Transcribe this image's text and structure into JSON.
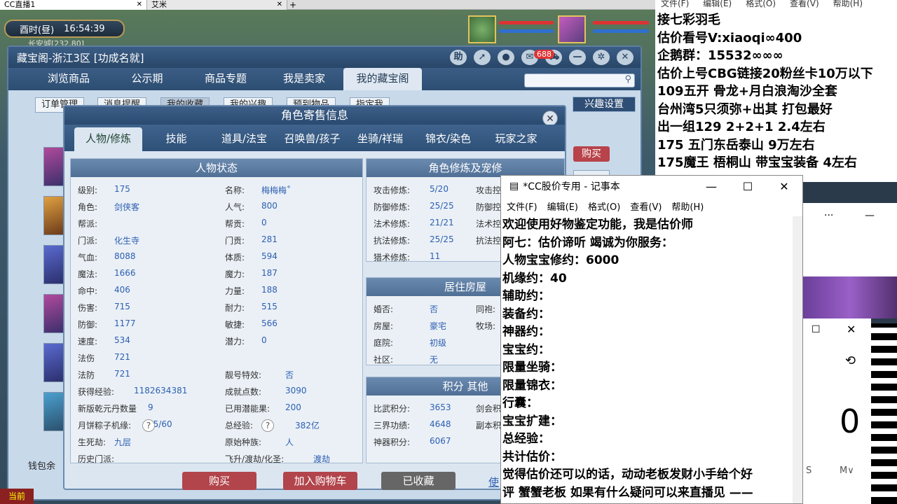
{
  "browser": {
    "tabs": [
      {
        "label": "CC直播1",
        "active": true
      },
      {
        "label": "艾米",
        "active": false
      }
    ]
  },
  "game": {
    "clock": {
      "period": "酉时(昼)",
      "time": "16:54:39"
    },
    "location": "长安城[232,80]",
    "window_title": "藏宝阁-浙江3区 [功成名就]",
    "help_label": "助",
    "cart_badge": "688",
    "nav_tabs": [
      "浏览商品",
      "公示期",
      "商品专题",
      "我是卖家",
      "我的藏宝阁"
    ],
    "sub_tabs": [
      "订单管理",
      "消息提醒",
      "我的收藏",
      "我的兴趣",
      "预到物品",
      "指定我"
    ],
    "interest_setting": "兴趣设置",
    "buy_side": "购买",
    "wallet": "钱包余"
  },
  "dialog": {
    "title": "角色寄售信息",
    "tabs": [
      "人物/修炼",
      "技能",
      "道具/法宝",
      "召唤兽/孩子",
      "坐骑/祥瑞",
      "锦衣/染色",
      "玩家之家"
    ],
    "status_title": "人物状态",
    "col1": [
      {
        "label": "级别:",
        "value": "175"
      },
      {
        "label": "角色:",
        "value": "剑侠客"
      },
      {
        "label": "帮派:",
        "value": ""
      },
      {
        "label": "门派:",
        "value": "化生寺"
      },
      {
        "label": "气血:",
        "value": "8088"
      },
      {
        "label": "魔法:",
        "value": "1666"
      },
      {
        "label": "命中:",
        "value": "406"
      },
      {
        "label": "伤害:",
        "value": "715"
      },
      {
        "label": "防御:",
        "value": "1177"
      },
      {
        "label": "速度:",
        "value": "534"
      },
      {
        "label": "法伤",
        "value": "721"
      },
      {
        "label": "法防",
        "value": "721"
      },
      {
        "label": "获得经验:",
        "value": "1182634381"
      },
      {
        "label": "新版乾元丹数量",
        "value": "9"
      },
      {
        "label": "月饼粽子机缘:",
        "value": "35/60"
      },
      {
        "label": "生死劫:",
        "value": "九层"
      },
      {
        "label": "历史门派:",
        "value": ""
      }
    ],
    "col2": [
      {
        "label": "名称:",
        "value": "梅梅梅˚"
      },
      {
        "label": "人气:",
        "value": "800"
      },
      {
        "label": "帮贡:",
        "value": "0"
      },
      {
        "label": "门贡:",
        "value": "281"
      },
      {
        "label": "体质:",
        "value": "594"
      },
      {
        "label": "魔力:",
        "value": "187"
      },
      {
        "label": "力量:",
        "value": "188"
      },
      {
        "label": "耐力:",
        "value": "515"
      },
      {
        "label": "敏捷:",
        "value": "566"
      },
      {
        "label": "潜力:",
        "value": "0"
      },
      {
        "label": "靓号特效:",
        "value": "否"
      },
      {
        "label": "成就点数:",
        "value": "3090"
      },
      {
        "label": "已用潜能果:",
        "value": "200"
      },
      {
        "label": "总经验:",
        "value": "382亿"
      },
      {
        "label": "原始种族:",
        "value": "人"
      },
      {
        "label": "飞升/渡劫/化圣:",
        "value": "渡劫"
      }
    ],
    "cultivation_title": "角色修炼及宠修",
    "cultivation": [
      {
        "label": "攻击修炼:",
        "value": "5/20",
        "side": "攻击控"
      },
      {
        "label": "防御修炼:",
        "value": "25/25",
        "side": "防御控"
      },
      {
        "label": "法术修炼:",
        "value": "21/21",
        "side": "法术控"
      },
      {
        "label": "抗法修炼:",
        "value": "25/25",
        "side": "抗法控"
      },
      {
        "label": "猎术修炼:",
        "value": "11",
        "side": ""
      }
    ],
    "house_title": "居住房屋",
    "house": [
      {
        "label": "婚否:",
        "value": "否",
        "side": "同袍:"
      },
      {
        "label": "房屋:",
        "value": "豪宅",
        "side": "牧场:"
      },
      {
        "label": "庭院:",
        "value": "初级",
        "side": ""
      },
      {
        "label": "社区:",
        "value": "无",
        "side": ""
      }
    ],
    "score_title": "积分 其他",
    "score": [
      {
        "label": "比武积分:",
        "value": "3653",
        "side": "剑会积"
      },
      {
        "label": "三界功绩:",
        "value": "4648",
        "side": "副本积"
      },
      {
        "label": "神器积分:",
        "value": "6067",
        "side": ""
      }
    ],
    "buttons": {
      "buy": "购买",
      "add_cart": "加入购物车",
      "collected": "已收藏",
      "link": "使"
    }
  },
  "overlay_text": {
    "menu": [
      "文件(F)",
      "编辑(E)",
      "格式(O)",
      "查看(V)",
      "帮助(H)"
    ],
    "lines": [
      "  接七彩羽毛",
      "估价看号V:xiaoqi∞400",
      "企鹅群：15532∞∞∞",
      "估价上号CBG链接20粉丝卡10万以下",
      "109五开 骨龙+月白浪淘沙全套",
      "台州湾5只须弥+出其 打包最好",
      "出一组129 2+2+1    2.4左右",
      "175 五门东岳泰山  9万左右",
      "175魔王 梧桐山  带宝宝装备 4左右"
    ]
  },
  "notepad": {
    "title": "*CC股价专用 - 记事本",
    "menu": [
      "文件(F)",
      "编辑(E)",
      "格式(O)",
      "查看(V)",
      "帮助(H)"
    ],
    "lines": [
      "欢迎使用好物鉴定功能，我是估价师",
      "阿七：估价谛听 竭诚为你服务：",
      "人物宝宝修约：6000",
      "机缘约：40",
      "辅助约：",
      "装备约：",
      "神器约：",
      "宝宝约：",
      "限量坐骑：",
      "限量锦衣：",
      "行囊：",
      "宝宝扩建：",
      "总经验：",
      "共计估价：",
      "觉得估价还可以的话，动动老板发财小手给个好",
      "评 蟹蟹老板 如果有什么疑问可以来直播见 ——"
    ]
  },
  "side_widget": {
    "digit": "0",
    "label_s": "S",
    "label_m": "M∨"
  },
  "bottom_bar": {
    "label": "当前"
  }
}
